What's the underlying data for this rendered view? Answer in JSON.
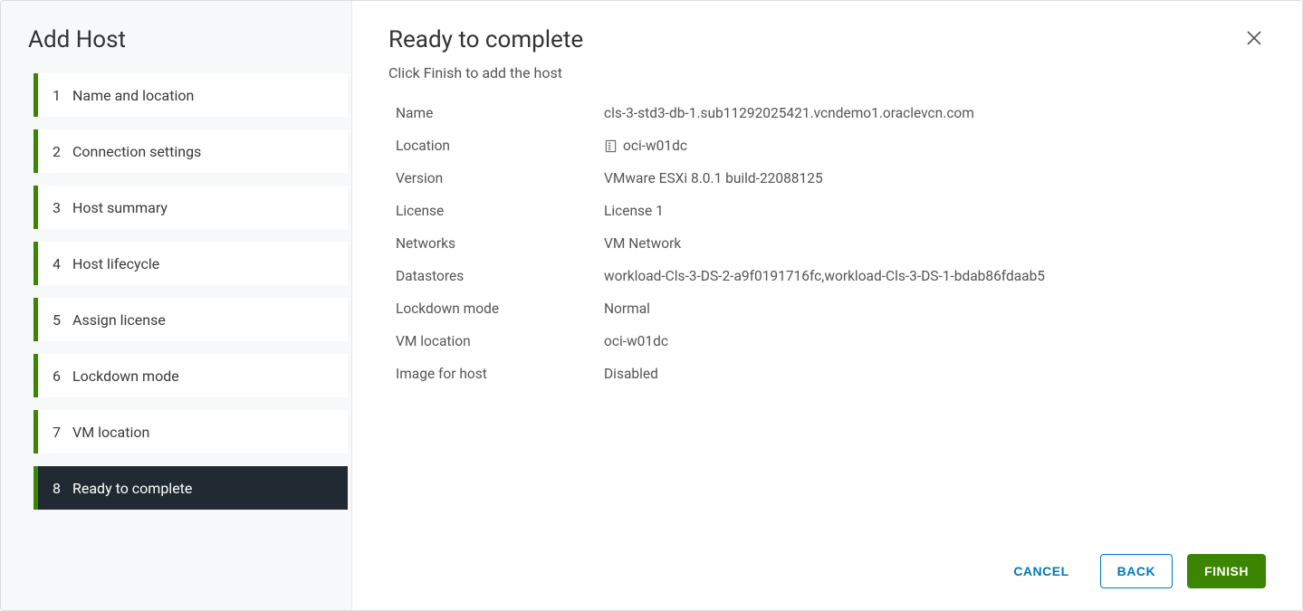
{
  "wizard": {
    "title": "Add Host",
    "steps": [
      {
        "num": "1",
        "label": "Name and location"
      },
      {
        "num": "2",
        "label": "Connection settings"
      },
      {
        "num": "3",
        "label": "Host summary"
      },
      {
        "num": "4",
        "label": "Host lifecycle"
      },
      {
        "num": "5",
        "label": "Assign license"
      },
      {
        "num": "6",
        "label": "Lockdown mode"
      },
      {
        "num": "7",
        "label": "VM location"
      },
      {
        "num": "8",
        "label": "Ready to complete"
      }
    ]
  },
  "content": {
    "title": "Ready to complete",
    "subtitle": "Click Finish to add the host"
  },
  "summary": {
    "labels": {
      "name": "Name",
      "location": "Location",
      "version": "Version",
      "license": "License",
      "networks": "Networks",
      "datastores": "Datastores",
      "lockdown": "Lockdown mode",
      "vmlocation": "VM location",
      "imagehost": "Image for host"
    },
    "values": {
      "name": "cls-3-std3-db-1.sub11292025421.vcndemo1.oraclevcn.com",
      "location": "oci-w01dc",
      "version": "VMware ESXi 8.0.1 build-22088125",
      "license": "License 1",
      "networks": "VM Network",
      "datastores": "workload-Cls-3-DS-2-a9f0191716fc,workload-Cls-3-DS-1-bdab86fdaab5",
      "lockdown": "Normal",
      "vmlocation": "oci-w01dc",
      "imagehost": "Disabled"
    }
  },
  "actions": {
    "cancel": "CANCEL",
    "back": "BACK",
    "finish": "FINISH"
  }
}
